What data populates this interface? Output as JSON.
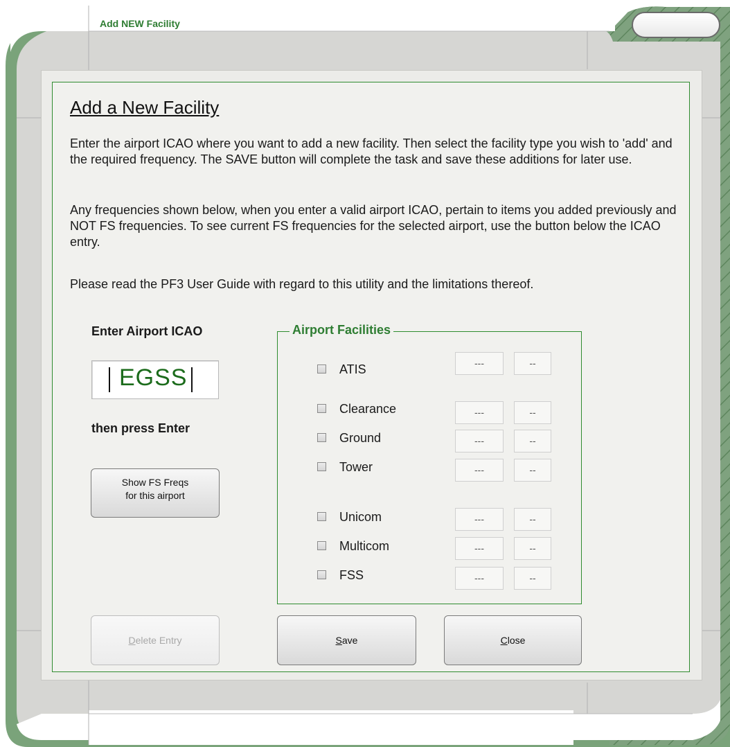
{
  "window": {
    "title": "Add NEW Facility"
  },
  "content": {
    "heading": "Add a New Facility",
    "paragraphs": [
      "Enter the airport ICAO where you want to add a new facility. Then select the facility type you wish to 'add' and the required frequency. The SAVE button will complete the task and save these additions for later use.",
      "Any frequencies shown below, when you enter a valid airport ICAO, pertain to items you added previously and NOT FS frequencies. To see current FS frequencies for the selected airport, use the button below the ICAO entry.",
      "Please read the PF3 User Guide with regard to this utility and the limitations thereof."
    ]
  },
  "icao": {
    "label": "Enter Airport ICAO",
    "value": "EGSS",
    "hint": "then press Enter",
    "show_freqs_line1": "Show FS Freqs",
    "show_freqs_line2": "for this airport"
  },
  "facilities": {
    "title": "Airport Facilities",
    "items": [
      {
        "label": "ATIS",
        "mhz": "---",
        "khz": "--",
        "checked": false
      },
      {
        "label": "Clearance",
        "mhz": "---",
        "khz": "--",
        "checked": false
      },
      {
        "label": "Ground",
        "mhz": "---",
        "khz": "--",
        "checked": false
      },
      {
        "label": "Tower",
        "mhz": "---",
        "khz": "--",
        "checked": false
      },
      {
        "label": "Unicom",
        "mhz": "---",
        "khz": "--",
        "checked": false
      },
      {
        "label": "Multicom",
        "mhz": "---",
        "khz": "--",
        "checked": false
      },
      {
        "label": "FSS",
        "mhz": "---",
        "khz": "--",
        "checked": false
      }
    ]
  },
  "buttons": {
    "delete_mnemonic": "D",
    "delete_rest": "elete Entry",
    "save_mnemonic": "S",
    "save_rest": "ave",
    "close_mnemonic": "C",
    "close_rest": "lose"
  },
  "colors": {
    "accent_green": "#2e7d32",
    "frame_green": "#7aa37a"
  }
}
